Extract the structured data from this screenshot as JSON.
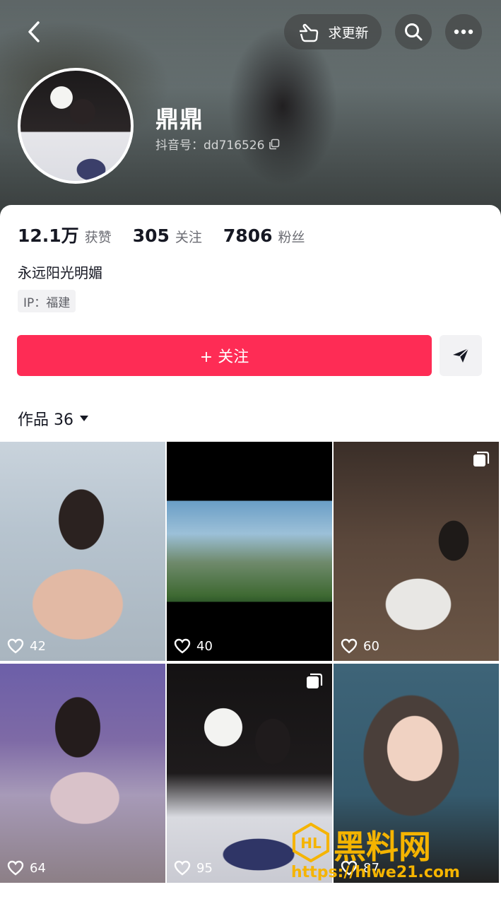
{
  "header": {
    "back_icon": "chevron-left-icon",
    "request_update_label": "求更新",
    "request_update_icon": "pointing-hand-icon",
    "search_icon": "search-icon",
    "more_icon": "more-dots-icon"
  },
  "profile": {
    "name": "鼎鼎",
    "douyin_id": "抖音号：dd716526",
    "copy_icon": "copy-icon"
  },
  "stats": [
    {
      "value": "12.1万",
      "label": "获赞"
    },
    {
      "value": "305",
      "label": "关注"
    },
    {
      "value": "7806",
      "label": "粉丝"
    }
  ],
  "bio": "永远阳光明媚",
  "ip": "IP：福建",
  "actions": {
    "follow_label": "+ 关注",
    "share_icon": "send-icon"
  },
  "works": {
    "label": "作品 36",
    "dropdown_icon": "caret-down-icon"
  },
  "videos": [
    {
      "likes": "42",
      "multi": false
    },
    {
      "likes": "40",
      "multi": false
    },
    {
      "likes": "60",
      "multi": true
    },
    {
      "likes": "64",
      "multi": false
    },
    {
      "likes": "95",
      "multi": true
    },
    {
      "likes": "87",
      "multi": false
    }
  ],
  "watermark": {
    "text": "黑料网",
    "url": "https://hlwe21.com",
    "logo_text": "HL"
  },
  "colors": {
    "accent": "#fe2c55",
    "watermark": "#f5b400"
  }
}
